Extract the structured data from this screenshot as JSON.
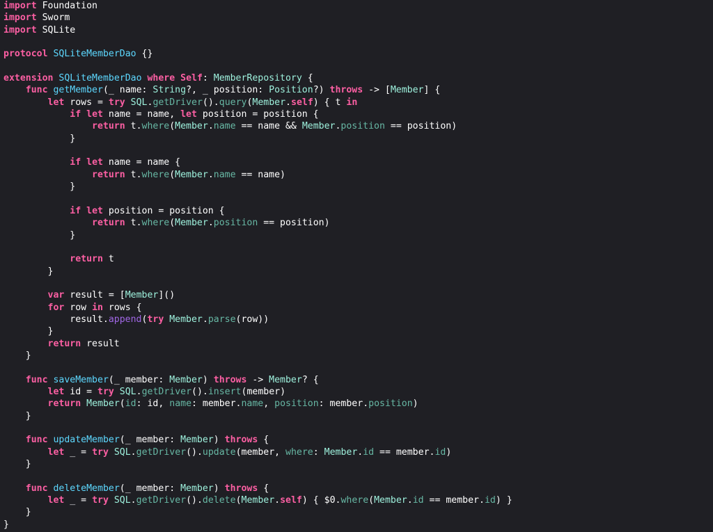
{
  "editor": {
    "background": "#1f1f24",
    "colors": {
      "keyword": "#fc5fa3",
      "project_type": "#9ef1dd",
      "project_member": "#67b7a4",
      "declaration": "#5dd8ff",
      "system_method": "#a167e6",
      "plain": "#ffffff"
    },
    "lines": [
      [
        [
          "kw",
          "import"
        ],
        [
          "pl",
          " Foundation"
        ]
      ],
      [
        [
          "kw",
          "import"
        ],
        [
          "pl",
          " Sworm"
        ]
      ],
      [
        [
          "kw",
          "import"
        ],
        [
          "pl",
          " SQLite"
        ]
      ],
      [],
      [
        [
          "kw",
          "protocol"
        ],
        [
          "pl",
          " "
        ],
        [
          "dec",
          "SQLiteMemberDao"
        ],
        [
          "pl",
          " {}"
        ]
      ],
      [],
      [
        [
          "kw",
          "extension"
        ],
        [
          "pl",
          " "
        ],
        [
          "dec",
          "SQLiteMemberDao"
        ],
        [
          "pl",
          " "
        ],
        [
          "kw",
          "where"
        ],
        [
          "pl",
          " "
        ],
        [
          "kw",
          "Self"
        ],
        [
          "pl",
          ": "
        ],
        [
          "prj",
          "MemberRepository"
        ],
        [
          "pl",
          " {"
        ]
      ],
      [
        [
          "pl",
          "    "
        ],
        [
          "kw",
          "func"
        ],
        [
          "pl",
          " "
        ],
        [
          "dec",
          "getMember"
        ],
        [
          "pl",
          "(_ name: "
        ],
        [
          "prj",
          "String"
        ],
        [
          "pl",
          "?, _ position: "
        ],
        [
          "prj",
          "Position"
        ],
        [
          "pl",
          "?) "
        ],
        [
          "kw",
          "throws"
        ],
        [
          "pl",
          " -> ["
        ],
        [
          "prj",
          "Member"
        ],
        [
          "pl",
          "] {"
        ]
      ],
      [
        [
          "pl",
          "        "
        ],
        [
          "kw",
          "let"
        ],
        [
          "pl",
          " rows = "
        ],
        [
          "kw",
          "try"
        ],
        [
          "pl",
          " "
        ],
        [
          "prj",
          "SQL"
        ],
        [
          "pl",
          "."
        ],
        [
          "fn",
          "getDriver"
        ],
        [
          "pl",
          "()."
        ],
        [
          "fn",
          "query"
        ],
        [
          "pl",
          "("
        ],
        [
          "prj",
          "Member"
        ],
        [
          "pl",
          "."
        ],
        [
          "kw",
          "self"
        ],
        [
          "pl",
          ") { t "
        ],
        [
          "kw",
          "in"
        ]
      ],
      [
        [
          "pl",
          "            "
        ],
        [
          "kw",
          "if"
        ],
        [
          "pl",
          " "
        ],
        [
          "kw",
          "let"
        ],
        [
          "pl",
          " name = name, "
        ],
        [
          "kw",
          "let"
        ],
        [
          "pl",
          " position = position {"
        ]
      ],
      [
        [
          "pl",
          "                "
        ],
        [
          "kw",
          "return"
        ],
        [
          "pl",
          " t."
        ],
        [
          "fn",
          "where"
        ],
        [
          "pl",
          "("
        ],
        [
          "prj",
          "Member"
        ],
        [
          "pl",
          "."
        ],
        [
          "fn",
          "name"
        ],
        [
          "pl",
          " == name && "
        ],
        [
          "prj",
          "Member"
        ],
        [
          "pl",
          "."
        ],
        [
          "fn",
          "position"
        ],
        [
          "pl",
          " == position)"
        ]
      ],
      [
        [
          "pl",
          "            }"
        ]
      ],
      [],
      [
        [
          "pl",
          "            "
        ],
        [
          "kw",
          "if"
        ],
        [
          "pl",
          " "
        ],
        [
          "kw",
          "let"
        ],
        [
          "pl",
          " name = name {"
        ]
      ],
      [
        [
          "pl",
          "                "
        ],
        [
          "kw",
          "return"
        ],
        [
          "pl",
          " t."
        ],
        [
          "fn",
          "where"
        ],
        [
          "pl",
          "("
        ],
        [
          "prj",
          "Member"
        ],
        [
          "pl",
          "."
        ],
        [
          "fn",
          "name"
        ],
        [
          "pl",
          " == name)"
        ]
      ],
      [
        [
          "pl",
          "            }"
        ]
      ],
      [],
      [
        [
          "pl",
          "            "
        ],
        [
          "kw",
          "if"
        ],
        [
          "pl",
          " "
        ],
        [
          "kw",
          "let"
        ],
        [
          "pl",
          " position = position {"
        ]
      ],
      [
        [
          "pl",
          "                "
        ],
        [
          "kw",
          "return"
        ],
        [
          "pl",
          " t."
        ],
        [
          "fn",
          "where"
        ],
        [
          "pl",
          "("
        ],
        [
          "prj",
          "Member"
        ],
        [
          "pl",
          "."
        ],
        [
          "fn",
          "position"
        ],
        [
          "pl",
          " == position)"
        ]
      ],
      [
        [
          "pl",
          "            }"
        ]
      ],
      [],
      [
        [
          "pl",
          "            "
        ],
        [
          "kw",
          "return"
        ],
        [
          "pl",
          " t"
        ]
      ],
      [
        [
          "pl",
          "        }"
        ]
      ],
      [],
      [
        [
          "pl",
          "        "
        ],
        [
          "kw",
          "var"
        ],
        [
          "pl",
          " result = ["
        ],
        [
          "prj",
          "Member"
        ],
        [
          "pl",
          "]()"
        ]
      ],
      [
        [
          "pl",
          "        "
        ],
        [
          "kw",
          "for"
        ],
        [
          "pl",
          " row "
        ],
        [
          "kw",
          "in"
        ],
        [
          "pl",
          " rows {"
        ]
      ],
      [
        [
          "pl",
          "            result."
        ],
        [
          "met",
          "append"
        ],
        [
          "pl",
          "("
        ],
        [
          "kw",
          "try"
        ],
        [
          "pl",
          " "
        ],
        [
          "prj",
          "Member"
        ],
        [
          "pl",
          "."
        ],
        [
          "fn",
          "parse"
        ],
        [
          "pl",
          "(row))"
        ]
      ],
      [
        [
          "pl",
          "        }"
        ]
      ],
      [
        [
          "pl",
          "        "
        ],
        [
          "kw",
          "return"
        ],
        [
          "pl",
          " result"
        ]
      ],
      [
        [
          "pl",
          "    }"
        ]
      ],
      [],
      [
        [
          "pl",
          "    "
        ],
        [
          "kw",
          "func"
        ],
        [
          "pl",
          " "
        ],
        [
          "dec",
          "saveMember"
        ],
        [
          "pl",
          "(_ member: "
        ],
        [
          "prj",
          "Member"
        ],
        [
          "pl",
          ") "
        ],
        [
          "kw",
          "throws"
        ],
        [
          "pl",
          " -> "
        ],
        [
          "prj",
          "Member"
        ],
        [
          "pl",
          "? {"
        ]
      ],
      [
        [
          "pl",
          "        "
        ],
        [
          "kw",
          "let"
        ],
        [
          "pl",
          " id = "
        ],
        [
          "kw",
          "try"
        ],
        [
          "pl",
          " "
        ],
        [
          "prj",
          "SQL"
        ],
        [
          "pl",
          "."
        ],
        [
          "fn",
          "getDriver"
        ],
        [
          "pl",
          "()."
        ],
        [
          "fn",
          "insert"
        ],
        [
          "pl",
          "(member)"
        ]
      ],
      [
        [
          "pl",
          "        "
        ],
        [
          "kw",
          "return"
        ],
        [
          "pl",
          " "
        ],
        [
          "prj",
          "Member"
        ],
        [
          "pl",
          "("
        ],
        [
          "fn",
          "id"
        ],
        [
          "pl",
          ": id, "
        ],
        [
          "fn",
          "name"
        ],
        [
          "pl",
          ": member."
        ],
        [
          "fn",
          "name"
        ],
        [
          "pl",
          ", "
        ],
        [
          "fn",
          "position"
        ],
        [
          "pl",
          ": member."
        ],
        [
          "fn",
          "position"
        ],
        [
          "pl",
          ")"
        ]
      ],
      [
        [
          "pl",
          "    }"
        ]
      ],
      [],
      [
        [
          "pl",
          "    "
        ],
        [
          "kw",
          "func"
        ],
        [
          "pl",
          " "
        ],
        [
          "dec",
          "updateMember"
        ],
        [
          "pl",
          "(_ member: "
        ],
        [
          "prj",
          "Member"
        ],
        [
          "pl",
          ") "
        ],
        [
          "kw",
          "throws"
        ],
        [
          "pl",
          " {"
        ]
      ],
      [
        [
          "pl",
          "        "
        ],
        [
          "kw",
          "let"
        ],
        [
          "pl",
          " _ = "
        ],
        [
          "kw",
          "try"
        ],
        [
          "pl",
          " "
        ],
        [
          "prj",
          "SQL"
        ],
        [
          "pl",
          "."
        ],
        [
          "fn",
          "getDriver"
        ],
        [
          "pl",
          "()."
        ],
        [
          "fn",
          "update"
        ],
        [
          "pl",
          "(member, "
        ],
        [
          "fn",
          "where"
        ],
        [
          "pl",
          ": "
        ],
        [
          "prj",
          "Member"
        ],
        [
          "pl",
          "."
        ],
        [
          "fn",
          "id"
        ],
        [
          "pl",
          " == member."
        ],
        [
          "fn",
          "id"
        ],
        [
          "pl",
          ")"
        ]
      ],
      [
        [
          "pl",
          "    }"
        ]
      ],
      [],
      [
        [
          "pl",
          "    "
        ],
        [
          "kw",
          "func"
        ],
        [
          "pl",
          " "
        ],
        [
          "dec",
          "deleteMember"
        ],
        [
          "pl",
          "(_ member: "
        ],
        [
          "prj",
          "Member"
        ],
        [
          "pl",
          ") "
        ],
        [
          "kw",
          "throws"
        ],
        [
          "pl",
          " {"
        ]
      ],
      [
        [
          "pl",
          "        "
        ],
        [
          "kw",
          "let"
        ],
        [
          "pl",
          " _ = "
        ],
        [
          "kw",
          "try"
        ],
        [
          "pl",
          " "
        ],
        [
          "prj",
          "SQL"
        ],
        [
          "pl",
          "."
        ],
        [
          "fn",
          "getDriver"
        ],
        [
          "pl",
          "()."
        ],
        [
          "fn",
          "delete"
        ],
        [
          "pl",
          "("
        ],
        [
          "prj",
          "Member"
        ],
        [
          "pl",
          "."
        ],
        [
          "kw",
          "self"
        ],
        [
          "pl",
          ") { $0."
        ],
        [
          "fn",
          "where"
        ],
        [
          "pl",
          "("
        ],
        [
          "prj",
          "Member"
        ],
        [
          "pl",
          "."
        ],
        [
          "fn",
          "id"
        ],
        [
          "pl",
          " == member."
        ],
        [
          "fn",
          "id"
        ],
        [
          "pl",
          ") }"
        ]
      ],
      [
        [
          "pl",
          "    }"
        ]
      ],
      [
        [
          "pl",
          "}"
        ]
      ]
    ]
  }
}
